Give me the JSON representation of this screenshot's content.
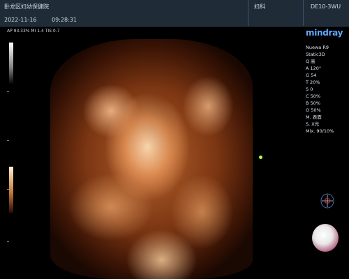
{
  "header": {
    "hospital": "卧龙区妇幼保健院",
    "date": "2022-11-16",
    "time": "09:28:31",
    "exam_mode": "妇科",
    "probe": "DE10-3WU"
  },
  "info_strip": {
    "text": "AP 93.33%  MI 1.4 TIS 0.7"
  },
  "right_panel": {
    "brand": "mindray",
    "params": [
      "Nuewa R9",
      "Static3D",
      "Q 高",
      "A 120°",
      "G 54",
      "T 20%",
      "S 0",
      "C 50%",
      "B 50%",
      "O 50%",
      "M. 表面",
      "S. X光",
      "Mix. 90/10%"
    ]
  },
  "colors": {
    "header_bg": "#1f2c38",
    "brand_blue": "#5fa9ff",
    "focus_marker": "#b8ff3a",
    "render_tone": "#b5622d"
  },
  "icons": [
    "orientation-cube-icon",
    "preview-sphere-icon",
    "focus-marker-icon"
  ]
}
